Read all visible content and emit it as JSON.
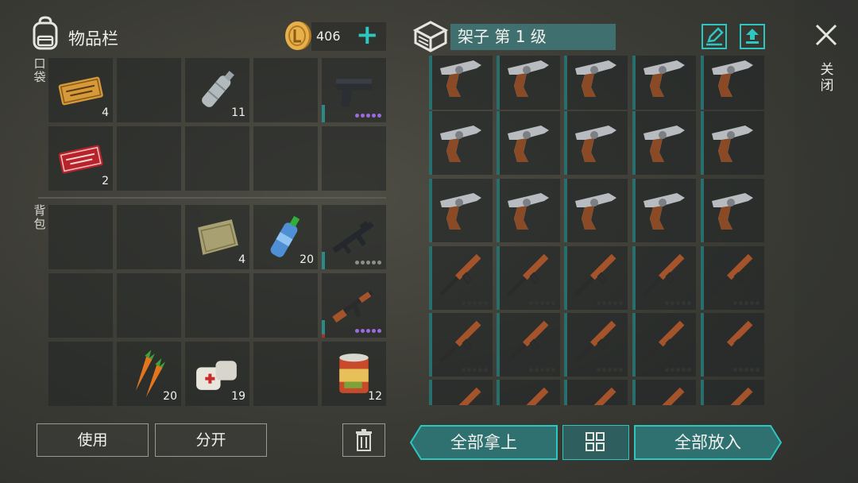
{
  "inventory": {
    "title": "物品栏",
    "coins": "406",
    "add_icon": "plus-icon",
    "pocket_label": "口袋",
    "backpack_label": "背包"
  },
  "pocket_slots": [
    {
      "icon": "survival-coupon",
      "qty": "4"
    },
    {
      "icon": "",
      "qty": ""
    },
    {
      "icon": "water-bottle-empty",
      "qty": "11"
    },
    {
      "icon": "",
      "qty": ""
    },
    {
      "icon": "pistol",
      "qty": "",
      "dots": "purple"
    },
    {
      "icon": "combat-gear-coupon",
      "qty": "2"
    },
    {
      "icon": "",
      "qty": ""
    },
    {
      "icon": "",
      "qty": ""
    },
    {
      "icon": "",
      "qty": ""
    },
    {
      "icon": "",
      "qty": ""
    }
  ],
  "backpack_slots": [
    {
      "icon": "",
      "qty": ""
    },
    {
      "icon": "",
      "qty": ""
    },
    {
      "icon": "cloth-rag",
      "qty": "4"
    },
    {
      "icon": "water-bottle-full",
      "qty": "20"
    },
    {
      "icon": "assault-rifle-m16",
      "qty": "",
      "dots": "grey"
    },
    {
      "icon": "",
      "qty": ""
    },
    {
      "icon": "",
      "qty": ""
    },
    {
      "icon": "",
      "qty": ""
    },
    {
      "icon": "",
      "qty": ""
    },
    {
      "icon": "ak-rifle",
      "qty": "",
      "dots": "purple"
    },
    {
      "icon": "",
      "qty": ""
    },
    {
      "icon": "carrots",
      "qty": "20"
    },
    {
      "icon": "bandage",
      "qty": "19"
    },
    {
      "icon": "",
      "qty": ""
    },
    {
      "icon": "canned-food",
      "qty": "12"
    }
  ],
  "shelf": {
    "title": "架子 第 1 级",
    "rows": [
      "revolver",
      "revolver",
      "revolver",
      "rifle",
      "rifle",
      "rifle"
    ]
  },
  "actions": {
    "use": "使用",
    "split": "分开",
    "take_all": "全部拿上",
    "put_all": "全部放入",
    "close": "关闭"
  },
  "colors": {
    "accent": "#2dc6c0",
    "purple_dots": "#9d6be0"
  }
}
